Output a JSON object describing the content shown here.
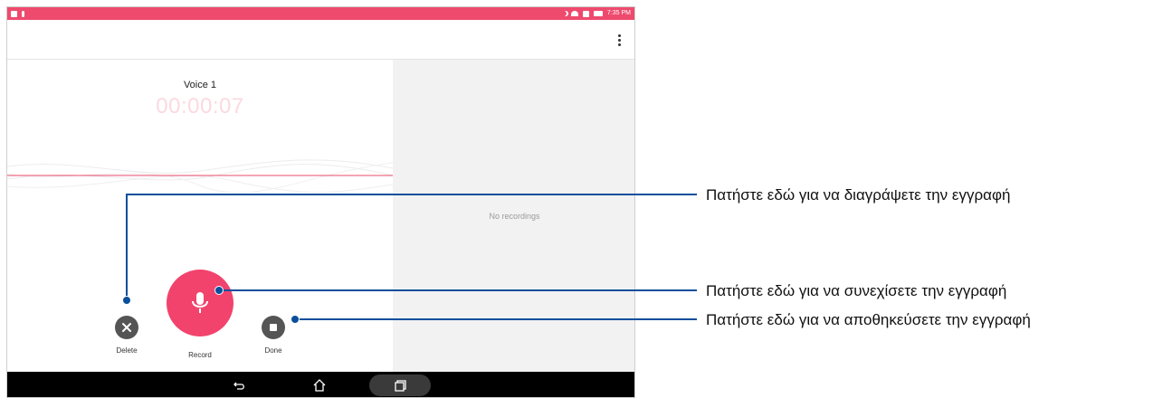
{
  "status_bar": {
    "time": "7:35 PM"
  },
  "recording": {
    "title": "Voice 1",
    "timer": "00:00:07"
  },
  "recordings_panel": {
    "empty_text": "No recordings"
  },
  "controls": {
    "delete_label": "Delete",
    "record_label": "Record",
    "done_label": "Done"
  },
  "callouts": [
    {
      "text": "Πατήστε εδώ για να διαγράψετε την εγγραφή"
    },
    {
      "text": "Πατήστε εδώ για να συνεχίσετε την εγγραφή"
    },
    {
      "text": "Πατήστε εδώ για να αποθηκεύσετε την εγγραφή"
    }
  ],
  "colors": {
    "accent": "#ee4a6e",
    "record_button": "#f2436c",
    "callout_line": "#0a4f9c",
    "timer_text": "#fbd9e1"
  },
  "icons": {
    "status_left": [
      "gallery-icon",
      "mic-icon"
    ],
    "status_right": [
      "moon-icon",
      "wifi-icon",
      "data-icon",
      "battery-icon"
    ],
    "menu": "more-vert-icon",
    "delete": "close-icon",
    "record": "microphone-icon",
    "done": "stop-icon",
    "nav": [
      "back-icon",
      "home-icon",
      "recent-apps-icon"
    ]
  }
}
